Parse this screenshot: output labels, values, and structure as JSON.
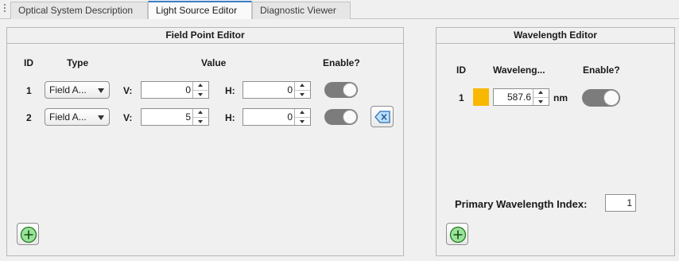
{
  "tabs": [
    {
      "label": "Optical System Description",
      "active": false
    },
    {
      "label": "Light Source Editor",
      "active": true
    },
    {
      "label": "Diagnostic Viewer",
      "active": false
    }
  ],
  "field_panel": {
    "title": "Field Point Editor",
    "headers": {
      "id": "ID",
      "type": "Type",
      "value": "Value",
      "enable": "Enable?"
    },
    "v_label": "V:",
    "h_label": "H:",
    "rows": [
      {
        "id": "1",
        "type": "Field A...",
        "v": "0",
        "h": "0",
        "enabled": true
      },
      {
        "id": "2",
        "type": "Field A...",
        "v": "5",
        "h": "0",
        "enabled": true
      }
    ],
    "icons": {
      "delete": "delete-row-icon",
      "add": "add-icon"
    }
  },
  "wavelength_panel": {
    "title": "Wavelength Editor",
    "headers": {
      "id": "ID",
      "wavelength": "Waveleng...",
      "enable": "Enable?"
    },
    "rows": [
      {
        "id": "1",
        "color": "#f9b800",
        "value": "587.6",
        "unit": "nm",
        "enabled": true
      }
    ],
    "primary_label": "Primary Wavelength Index:",
    "primary_value": "1",
    "icons": {
      "add": "add-icon"
    }
  },
  "colors": {
    "toggle_on": "#7c7c7c",
    "add_green": "#9be29b",
    "delete_blue": "#bfe0ff",
    "active_tab_accent": "#3a80c6"
  }
}
